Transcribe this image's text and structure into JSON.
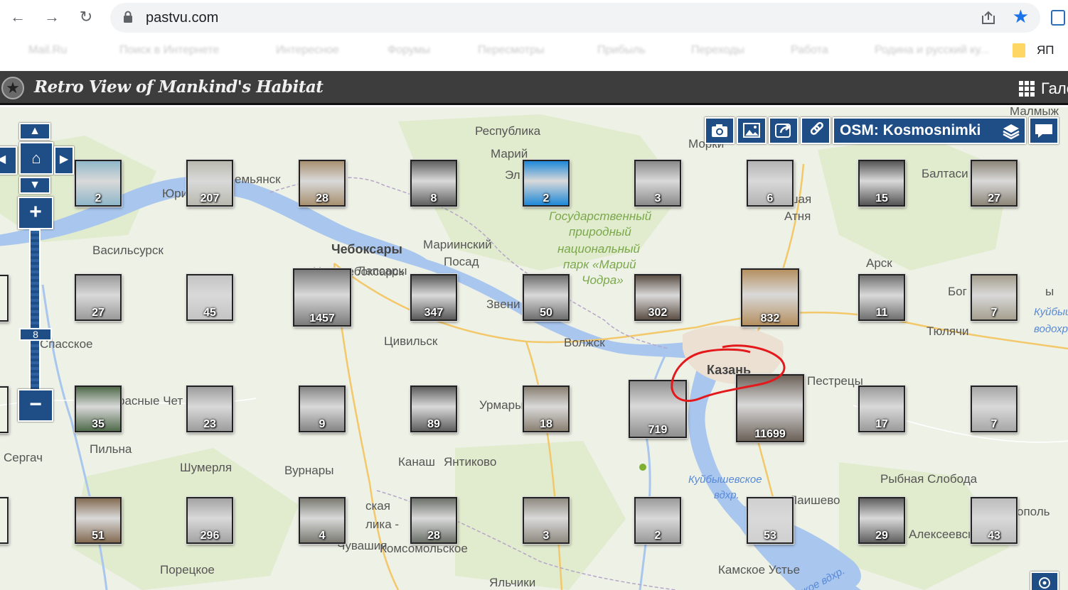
{
  "browser": {
    "back_icon": "←",
    "forward_icon": "→",
    "reload_icon": "↻",
    "url": "pastvu.com",
    "star_icon": "★",
    "bookmarks": [
      "Mail.Ru",
      "Поиск в Интернете",
      "Интересное",
      "Форумы",
      "Пересмотры",
      "Прибыль",
      "Переходы",
      "Работа",
      "Родина и русский ку..."
    ],
    "last_bookmark": "ЯП"
  },
  "site": {
    "title": "Retro View of Mankind's Habitat",
    "gallery_label": "Гале"
  },
  "map": {
    "layer_label": "OSM: Kosmosnimki",
    "zoom_level": "8",
    "zoom_in": "+",
    "zoom_out": "−",
    "places": [
      {
        "name": "Республика",
        "cls": ""
      },
      {
        "name": "Марий",
        "cls": ""
      },
      {
        "name": "Эл",
        "cls": ""
      },
      {
        "name": "Морки",
        "cls": ""
      },
      {
        "name": "Балтаси",
        "cls": ""
      },
      {
        "name": "Юри",
        "cls": ""
      },
      {
        "name": "емьянск",
        "cls": ""
      },
      {
        "name": "ьшая",
        "cls": ""
      },
      {
        "name": "Атня",
        "cls": ""
      },
      {
        "name": "Государственный",
        "cls": "green"
      },
      {
        "name": "природный",
        "cls": "green"
      },
      {
        "name": "национальный",
        "cls": "green"
      },
      {
        "name": "парк «Марий",
        "cls": "green"
      },
      {
        "name": "Чодра»",
        "cls": "green"
      },
      {
        "name": "Васильсурск",
        "cls": ""
      },
      {
        "name": "Чебоксары",
        "cls": "big"
      },
      {
        "name": "Мариинский",
        "cls": ""
      },
      {
        "name": "Посад",
        "cls": ""
      },
      {
        "name": "Новочебоксарск",
        "cls": ""
      },
      {
        "name": "Лапсары",
        "cls": ""
      },
      {
        "name": "Звени",
        "cls": ""
      },
      {
        "name": "Арск",
        "cls": ""
      },
      {
        "name": "Бог",
        "cls": ""
      },
      {
        "name": "ы",
        "cls": ""
      },
      {
        "name": "Куйбышевское",
        "cls": "water"
      },
      {
        "name": "водохранил",
        "cls": "water"
      },
      {
        "name": "Тюлячи",
        "cls": ""
      },
      {
        "name": "Спасское",
        "cls": ""
      },
      {
        "name": "Цивильск",
        "cls": ""
      },
      {
        "name": "Волжск",
        "cls": ""
      },
      {
        "name": "Казань",
        "cls": "big"
      },
      {
        "name": "Пестрецы",
        "cls": ""
      },
      {
        "name": "расные Чет",
        "cls": ""
      },
      {
        "name": "Урмары",
        "cls": ""
      },
      {
        "name": "Пильна",
        "cls": ""
      },
      {
        "name": "Сергач",
        "cls": ""
      },
      {
        "name": "Шумерля",
        "cls": ""
      },
      {
        "name": "Вурнары",
        "cls": ""
      },
      {
        "name": "Канаш",
        "cls": ""
      },
      {
        "name": "Янтиково",
        "cls": ""
      },
      {
        "name": "Куйбышевское",
        "cls": "water"
      },
      {
        "name": "вдхр.",
        "cls": "water"
      },
      {
        "name": "Рыбная Слобода",
        "cls": ""
      },
      {
        "name": "Лаишево",
        "cls": ""
      },
      {
        "name": "ополь",
        "cls": ""
      },
      {
        "name": "Алексеевское",
        "cls": ""
      },
      {
        "name": "ская",
        "cls": ""
      },
      {
        "name": "лика -",
        "cls": ""
      },
      {
        "name": "Чувашия",
        "cls": ""
      },
      {
        "name": "Комсомольское",
        "cls": ""
      },
      {
        "name": "Порецкое",
        "cls": ""
      },
      {
        "name": "Камское Устье",
        "cls": ""
      },
      {
        "name": "ское вдхр.",
        "cls": "water"
      },
      {
        "name": "Яльчики",
        "cls": ""
      },
      {
        "name": "Малмыж",
        "cls": ""
      }
    ],
    "clusters": [
      {
        "count": "2",
        "size": "m",
        "tone": "#8fb7c9"
      },
      {
        "count": "207",
        "size": "m",
        "tone": "#b9b9b0"
      },
      {
        "count": "28",
        "size": "m",
        "tone": "#a89070"
      },
      {
        "count": "8",
        "size": "m",
        "tone": "#606060"
      },
      {
        "count": "2",
        "size": "m",
        "tone": "#1e88d8"
      },
      {
        "count": "3",
        "size": "m",
        "tone": "#8a8a8a"
      },
      {
        "count": "6",
        "size": "m",
        "tone": "#b3b3b3"
      },
      {
        "count": "15",
        "size": "m",
        "tone": "#555555"
      },
      {
        "count": "27",
        "size": "m",
        "tone": "#8c8578"
      },
      {
        "count": "27",
        "size": "m",
        "tone": "#9a9a9a"
      },
      {
        "count": "45",
        "size": "m",
        "tone": "#c4c4c4"
      },
      {
        "count": "1457",
        "size": "l",
        "tone": "#7a7a7a"
      },
      {
        "count": "347",
        "size": "m",
        "tone": "#5a5a5a"
      },
      {
        "count": "50",
        "size": "m",
        "tone": "#6e6e6e"
      },
      {
        "count": "302",
        "size": "m",
        "tone": "#5c4f45"
      },
      {
        "count": "832",
        "size": "l",
        "tone": "#b59060"
      },
      {
        "count": "11",
        "size": "m",
        "tone": "#707070"
      },
      {
        "count": "7",
        "size": "m",
        "tone": "#a59f8e"
      },
      {
        "count": "35",
        "size": "m",
        "tone": "#4f6a4a"
      },
      {
        "count": "23",
        "size": "m",
        "tone": "#9d9d9d"
      },
      {
        "count": "9",
        "size": "m",
        "tone": "#858585"
      },
      {
        "count": "89",
        "size": "m",
        "tone": "#5e5e5e"
      },
      {
        "count": "18",
        "size": "m",
        "tone": "#8a8072"
      },
      {
        "count": "719",
        "size": "l",
        "tone": "#8f8f8f"
      },
      {
        "count": "11699",
        "size": "xl",
        "tone": "#6b6158"
      },
      {
        "count": "17",
        "size": "m",
        "tone": "#9b9b9b"
      },
      {
        "count": "7",
        "size": "m",
        "tone": "#a7a7a7"
      },
      {
        "count": "51",
        "size": "m",
        "tone": "#846b52"
      },
      {
        "count": "296",
        "size": "m",
        "tone": "#a3a3a3"
      },
      {
        "count": "4",
        "size": "m",
        "tone": "#7a7a72"
      },
      {
        "count": "28",
        "size": "m",
        "tone": "#6b7068"
      },
      {
        "count": "3",
        "size": "m",
        "tone": "#8f8a80"
      },
      {
        "count": "2",
        "size": "m",
        "tone": "#9a9a9a"
      },
      {
        "count": "53",
        "size": "m",
        "tone": "#d0d0d0"
      },
      {
        "count": "29",
        "size": "m",
        "tone": "#5f5f5f"
      },
      {
        "count": "43",
        "size": "m",
        "tone": "#bcbcbc"
      }
    ],
    "edge_clusters": 4
  }
}
